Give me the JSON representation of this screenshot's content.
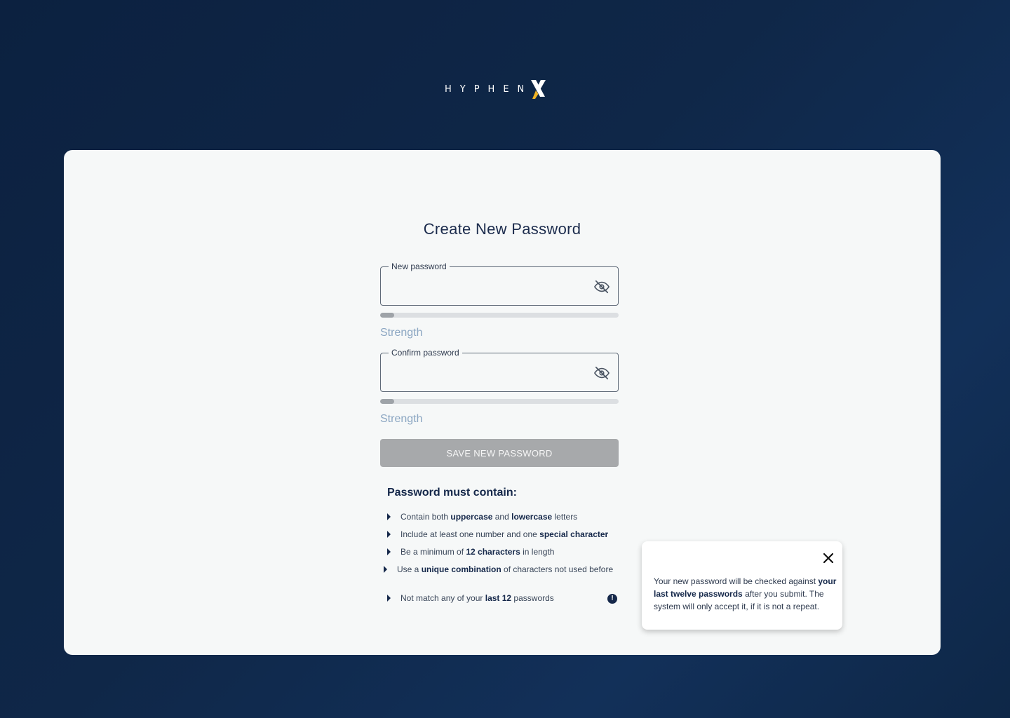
{
  "brand": {
    "logo_text": "HYPHEN",
    "accent_color": "#f0b323"
  },
  "form": {
    "title": "Create New Password",
    "new_password": {
      "label": "New password",
      "value": "",
      "strength_label": "Strength",
      "strength_fraction": 0.06,
      "icon": "eye-off-icon"
    },
    "confirm_password": {
      "label": "Confirm password",
      "value": "",
      "strength_label": "Strength",
      "strength_fraction": 0.06,
      "icon": "eye-off-icon"
    },
    "save_button_label": "SAVE NEW PASSWORD"
  },
  "requirements": {
    "title": "Password must contain:",
    "items": [
      {
        "parts": [
          {
            "t": "Contain both "
          },
          {
            "t": "uppercase",
            "b": true
          },
          {
            "t": " and "
          },
          {
            "t": "lowercase",
            "b": true
          },
          {
            "t": " letters"
          }
        ]
      },
      {
        "parts": [
          {
            "t": "Include at least one number and one "
          },
          {
            "t": "special character",
            "b": true
          }
        ]
      },
      {
        "parts": [
          {
            "t": "Be a minimum of "
          },
          {
            "t": "12 characters",
            "b": true
          },
          {
            "t": " in length"
          }
        ]
      },
      {
        "parts": [
          {
            "t": "Use a "
          },
          {
            "t": "unique combination",
            "b": true
          },
          {
            "t": " of characters not used before"
          }
        ]
      },
      {
        "parts": [
          {
            "t": "Not match any of your "
          },
          {
            "t": "last 12",
            "b": true
          },
          {
            "t": " passwords"
          }
        ]
      }
    ],
    "info_icon": "!"
  },
  "tooltip": {
    "parts": [
      {
        "t": "Your new password will be checked against "
      },
      {
        "t": "your last twelve passwords",
        "b": true
      },
      {
        "t": " after you submit. The system will only accept it, if it is not a repeat."
      }
    ]
  }
}
